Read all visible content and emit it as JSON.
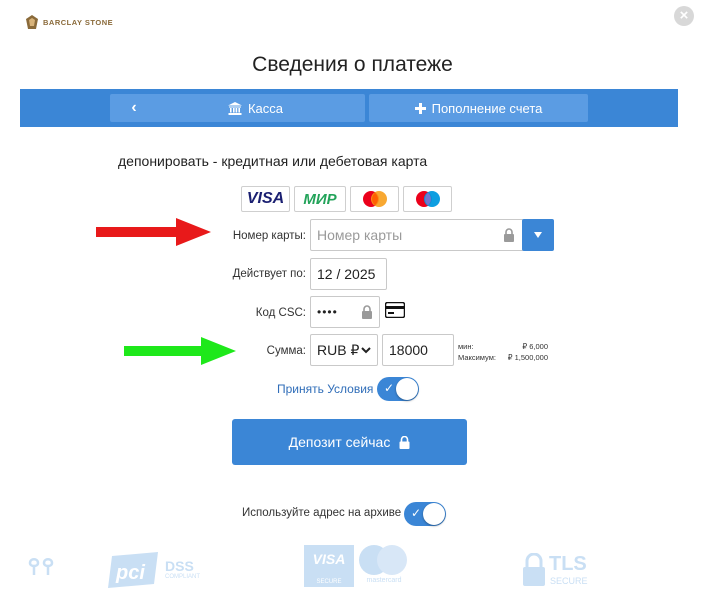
{
  "brand": {
    "name": "BARCLAY STONE"
  },
  "window": {
    "close_symbol": "×"
  },
  "page": {
    "title": "Сведения о платеже"
  },
  "toolbar": {
    "back_symbol": "‹",
    "kassa_label": "Касса",
    "topup_label": "Пополнение счета"
  },
  "subtitle": "депонировать - кредитная или дебетовая карта",
  "payment_methods": [
    "VISA",
    "МИР",
    "Mastercard",
    "Maestro"
  ],
  "form": {
    "card_number": {
      "label": "Номер карты:",
      "placeholder": "Номер карты",
      "value": ""
    },
    "expiry": {
      "label": "Действует по:",
      "value": "12 / 2025"
    },
    "csc": {
      "label": "Код CSC:",
      "value": "••••"
    },
    "amount": {
      "label": "Сумма:",
      "currency": "RUB ₽",
      "value": "18000",
      "min_label": "мин:",
      "min_value": "₽ 6,000",
      "max_label": "Максимум:",
      "max_value": "₽ 1,500,000"
    }
  },
  "terms": {
    "label": "Принять Условия",
    "checked": true
  },
  "deposit_button": {
    "label": "Депозит сейчас"
  },
  "archive_address": {
    "label": "Используйте адрес на архиве",
    "checked": true
  },
  "footer": {
    "pci_text": "DSS",
    "pci_sub": "COMPLIANT",
    "visa_text": "VISA",
    "secure_text": "SECURE",
    "mastercard_text": "mastercard",
    "tls_text": "TLS",
    "tls_sub": "SECURE"
  },
  "colors": {
    "primary": "#3b86d6",
    "button_light": "#5b9ce3",
    "red_arrow": "#e8191a",
    "green_arrow": "#1ee81a"
  }
}
